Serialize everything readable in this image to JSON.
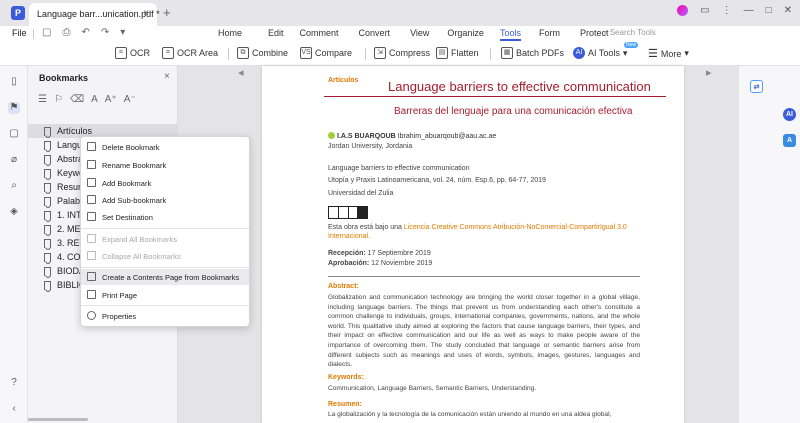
{
  "tabbar": {
    "tab_title": "Language  barr...unication.pdf *",
    "close": "×",
    "new_tab": "+"
  },
  "menubar": {
    "file": "File",
    "items": [
      "Home",
      "Edit",
      "Comment",
      "Convert",
      "View",
      "Organize",
      "Tools",
      "Form",
      "Protect"
    ],
    "active": "Tools",
    "search_placeholder": "Search Tools"
  },
  "toolbar": {
    "ocr": "OCR",
    "ocr_area": "OCR Area",
    "combine": "Combine",
    "compare": "Compare",
    "compress": "Compress",
    "flatten": "Flatten",
    "batch_pdfs": "Batch PDFs",
    "ai_tools": "AI Tools",
    "ai_badge": "New",
    "more": "More"
  },
  "bookmarks": {
    "title": "Bookmarks",
    "close": "×",
    "items": [
      "Artículos",
      "Langu",
      "Abstra",
      "Keywo",
      "Resum",
      "Palabr",
      "1. INTI",
      "2. MET",
      "3. RESI",
      "4. CON",
      "BIODA",
      "BIBLIC"
    ]
  },
  "context_menu": {
    "delete": "Delete Bookmark",
    "rename": "Rename Bookmark",
    "add": "Add Bookmark",
    "add_sub": "Add Sub-bookmark",
    "set_dest": "Set Destination",
    "expand_all": "Expand All Bookmarks",
    "collapse_all": "Collapse All Bookmarks",
    "create_contents": "Create a Contents Page from Bookmarks",
    "print_page": "Print Page",
    "properties": "Properties"
  },
  "page": {
    "section": "Artículos",
    "title": "Language barriers to effective communication",
    "subtitle": "Barreras del lenguaje para una comunicación efectiva",
    "author_name": "I.A.S BUARQOUB",
    "author_email": "Ibrahim_abuarqoub@aau.ac.ae",
    "affiliation": "Jordan University, Jordania",
    "ref_title": "Language barriers to effective communication",
    "journal": "Utopía y Praxis Latinoamericana, vol. 24, núm. Esp.6, pp. 64-77, 2019",
    "university": "Universidad del Zulia",
    "license_prefix": "Esta obra está bajo una ",
    "license_link": "Licencia Creative Commons Atribución-NoComercial-CompartirIgual 3.0 Internacional.",
    "received_label": "Recepción:",
    "received_date": " 17 Septiembre 2019",
    "approved_label": "Aprobación:",
    "approved_date": " 12 Noviembre 2019",
    "abstract_head": "Abstract:",
    "abstract_text": "Globalization and communication technology are bringing the world closer together in a global village, including language barriers. The things that prevent us from understanding each other's constitute a common challenge to individuals, groups, international companies, governments, nations, and the whole world. This qualitative study aimed at exploring the factors that cause language barriers, their types, and their impact on effective communication and our life as well as ways to make people aware of the importance of overcoming them. The study concluded that language or semantic barriers arise from different subjects such as meanings and uses of words, symbols, images, gestures, languages and dialects.",
    "keywords_head": "Keywords:",
    "keywords_text": "Communication, Language Barriers, Semantic Barriers, Understanding.",
    "resumen_head": "Resumen:",
    "resumen_text": "La globalización y la tecnología de la comunicación están uniendo al mundo en una aldea global,"
  }
}
